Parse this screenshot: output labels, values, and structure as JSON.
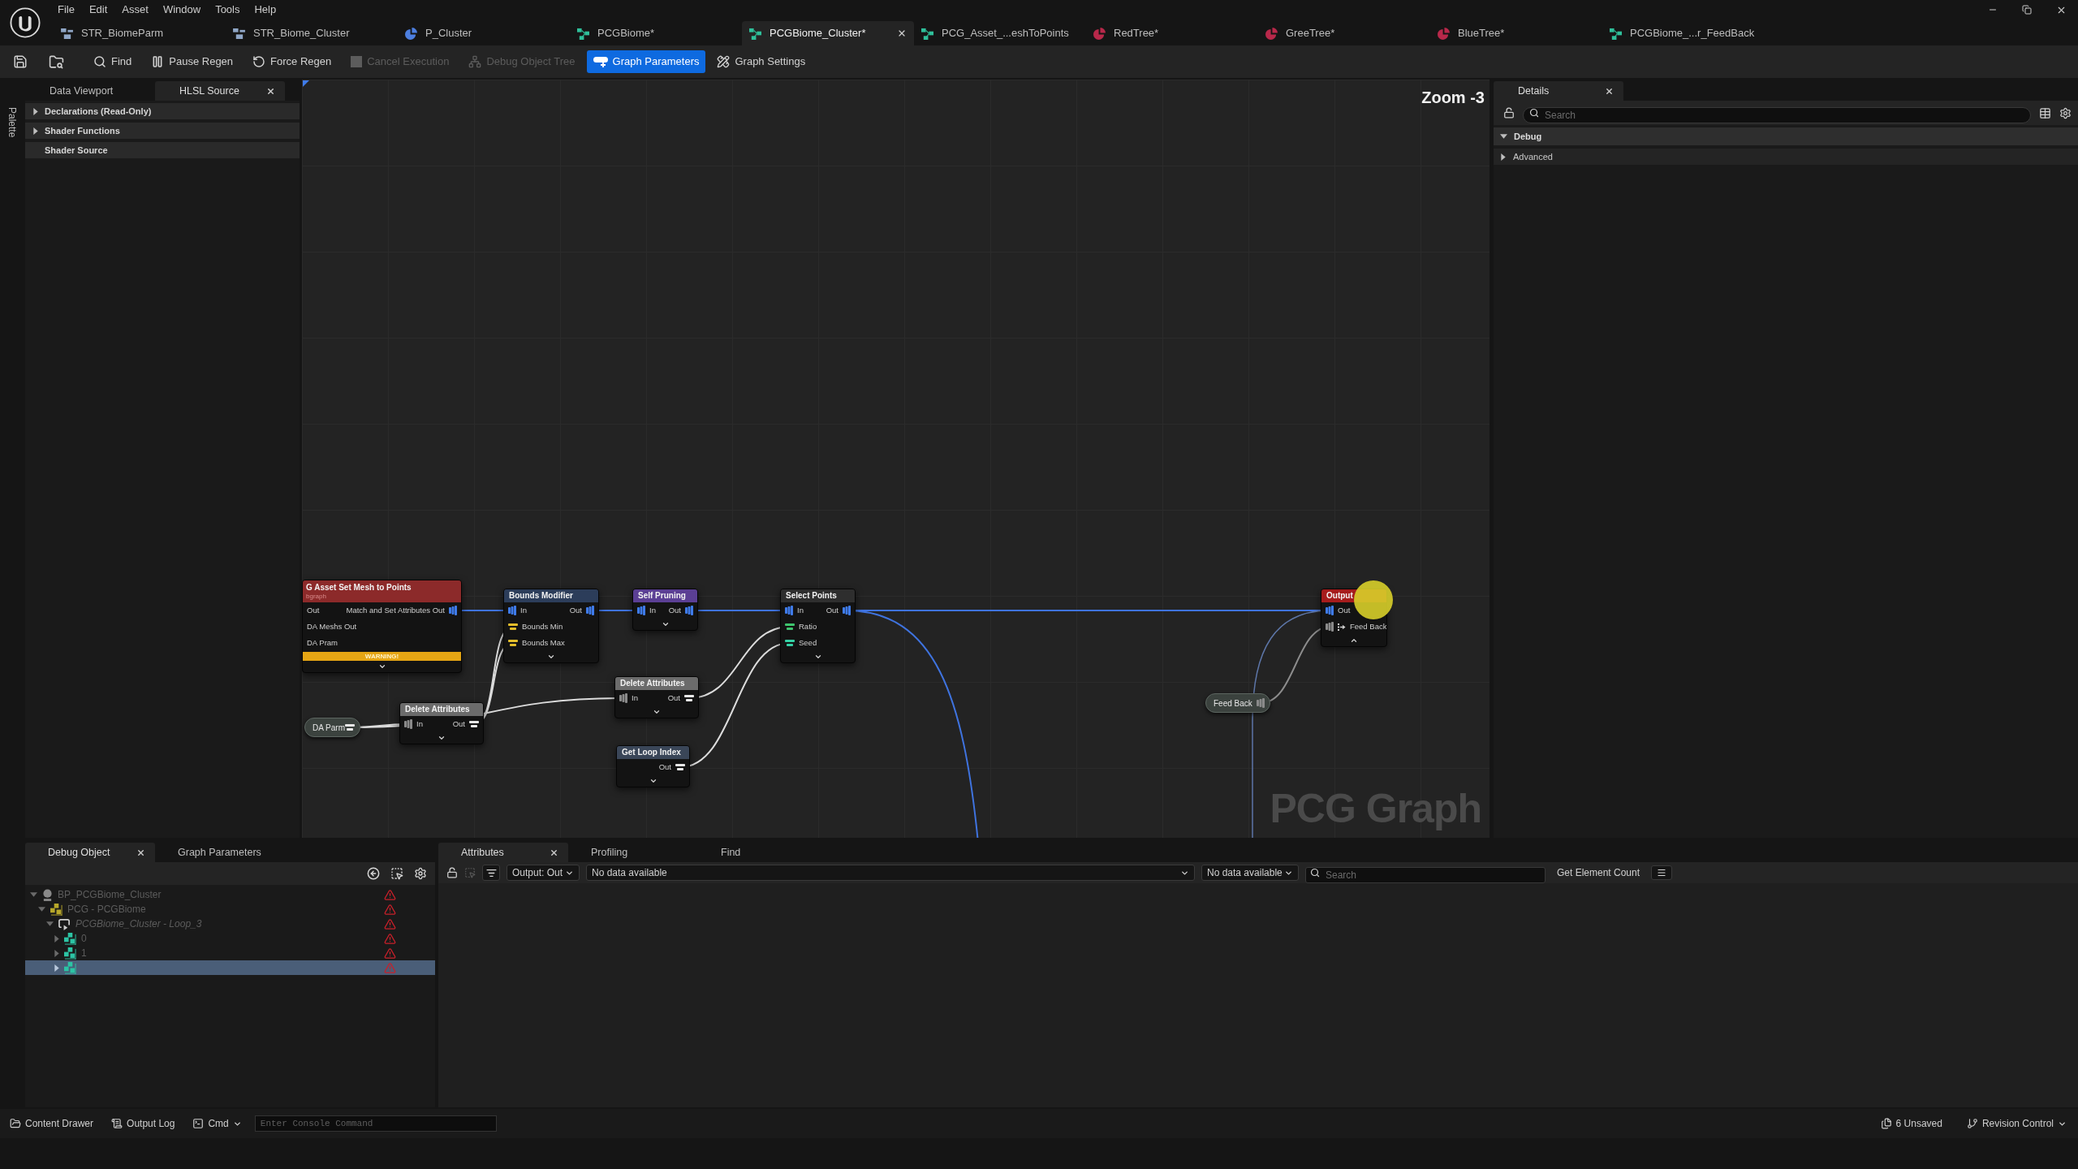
{
  "menu": [
    "File",
    "Edit",
    "Asset",
    "Window",
    "Tools",
    "Help"
  ],
  "tabs": [
    {
      "label": "STR_BiomeParm",
      "kind": "struct",
      "selected": false,
      "closable": false
    },
    {
      "label": "STR_Biome_Cluster",
      "kind": "struct",
      "selected": false,
      "closable": false
    },
    {
      "label": "P_Cluster",
      "kind": "data",
      "selected": false,
      "closable": false
    },
    {
      "label": "PCGBiome*",
      "kind": "graph",
      "selected": false,
      "closable": false
    },
    {
      "label": "PCGBiome_Cluster*",
      "kind": "graph",
      "selected": true,
      "closable": true
    },
    {
      "label": "PCG_Asset_...eshToPoints",
      "kind": "graph",
      "selected": false,
      "closable": false
    },
    {
      "label": "RedTree*",
      "kind": "material",
      "selected": false,
      "closable": false
    },
    {
      "label": "GreeTree*",
      "kind": "material",
      "selected": false,
      "closable": false
    },
    {
      "label": "BlueTree*",
      "kind": "material",
      "selected": false,
      "closable": false
    },
    {
      "label": "PCGBiome_...r_FeedBack",
      "kind": "graph",
      "selected": false,
      "closable": false
    }
  ],
  "toolbar": [
    {
      "label": "Find",
      "kind": "find",
      "disabled": false,
      "selected": false
    },
    {
      "label": "Pause Regen",
      "kind": "pause",
      "disabled": false,
      "selected": false
    },
    {
      "label": "Force Regen",
      "kind": "regen",
      "disabled": false,
      "selected": false
    },
    {
      "label": "Cancel Execution",
      "kind": "cancel",
      "disabled": true,
      "selected": false
    },
    {
      "label": "Debug Object Tree",
      "kind": "tree",
      "disabled": true,
      "selected": false
    },
    {
      "label": "Graph Parameters",
      "kind": "parameters",
      "disabled": false,
      "selected": true
    },
    {
      "label": "Graph Settings",
      "kind": "settings",
      "disabled": false,
      "selected": false
    }
  ],
  "palette": {
    "label": "Palette"
  },
  "left_panel": {
    "tabs": [
      {
        "label": "Data Viewport",
        "selected": false,
        "closable": false
      },
      {
        "label": "HLSL Source",
        "selected": true,
        "closable": true
      }
    ],
    "sections": [
      {
        "label": "Declarations (Read-Only)",
        "expandable": true
      },
      {
        "label": "Shader Functions",
        "expandable": true
      },
      {
        "label": "Shader Source",
        "expandable": false
      }
    ]
  },
  "graph": {
    "zoom": "Zoom -3",
    "watermark": "PCG Graph",
    "nodes": [
      {
        "kind": "node",
        "title": "G Asset Set Mesh to Points",
        "subtitle": "bgraph",
        "color": "#8c2a2a",
        "inputs": [
          {
            "label": "Out"
          },
          {
            "label": "DA Meshs Out"
          },
          {
            "label": "DA Pram"
          }
        ],
        "outputs": [
          {
            "label": "Match and Set Attributes Out",
            "kind": "point",
            "color": "#3f7bea"
          }
        ],
        "warning": "WARNING!",
        "expanded": false
      },
      {
        "kind": "node",
        "title": "Bounds Modifier",
        "color": "#2c3d5a",
        "inputs": [
          {
            "label": "In",
            "kind": "point",
            "color": "#3f7bea"
          },
          {
            "label": "Bounds Min",
            "kind": "param",
            "color": "#e3bd2a"
          },
          {
            "label": "Bounds Max",
            "kind": "param",
            "color": "#e3bd2a"
          }
        ],
        "outputs": [
          {
            "label": "Out",
            "kind": "point",
            "color": "#3f7bea"
          }
        ],
        "expanded": false
      },
      {
        "kind": "node",
        "title": "Self Pruning",
        "color": "#5b3f94",
        "inputs": [
          {
            "label": "In",
            "kind": "point",
            "color": "#3f7bea"
          }
        ],
        "outputs": [
          {
            "label": "Out",
            "kind": "point",
            "color": "#3f7bea"
          }
        ],
        "expanded": false
      },
      {
        "kind": "node",
        "title": "Select Points",
        "color": "#2e2e2e",
        "inputs": [
          {
            "label": "In",
            "kind": "point",
            "color": "#3f7bea"
          },
          {
            "label": "Ratio",
            "kind": "param",
            "color": "#3ec46d"
          },
          {
            "label": "Seed",
            "kind": "param",
            "color": "#35d0a5"
          }
        ],
        "outputs": [
          {
            "label": "Out",
            "kind": "point",
            "color": "#3f7bea"
          }
        ],
        "expanded": false
      },
      {
        "kind": "node",
        "title": "Output",
        "color": "#a61c1c",
        "inputs": [
          {
            "label": "Out",
            "kind": "point",
            "color": "#3f7bea",
            "loop_marker": false
          },
          {
            "label": "Feed Back",
            "kind": "spatial",
            "color": "#8a8a8a",
            "loop_marker": true
          }
        ],
        "expanded": true
      },
      {
        "kind": "pill",
        "title": "DA Parm",
        "color": "#3b423e",
        "outputs": [
          {
            "kind": "param",
            "color": "#e8e8e8"
          }
        ]
      },
      {
        "kind": "node",
        "title": "Delete Attributes",
        "color": "#6b6b6b",
        "inputs": [
          {
            "label": "In",
            "kind": "spatial",
            "color": "#8a8a8a"
          }
        ],
        "outputs": [
          {
            "label": "Out",
            "kind": "param",
            "color": "#e8e8e8"
          }
        ],
        "expanded": false
      },
      {
        "kind": "node",
        "title": "Delete Attributes",
        "color": "#6b6b6b",
        "inputs": [
          {
            "label": "In",
            "kind": "spatial",
            "color": "#8a8a8a"
          }
        ],
        "outputs": [
          {
            "label": "Out",
            "kind": "param",
            "color": "#e8e8e8"
          }
        ],
        "expanded": false
      },
      {
        "kind": "node",
        "title": "Get Loop Index",
        "color": "#3a4658",
        "outputs": [
          {
            "label": "Out",
            "kind": "param",
            "color": "#e8e8e8"
          }
        ],
        "expanded": false
      },
      {
        "kind": "pill",
        "title": "Feed Back",
        "color": "#3b423e",
        "outputs": [
          {
            "kind": "spatial",
            "color": "#8a8a8a"
          }
        ]
      }
    ]
  },
  "details": {
    "tab": {
      "label": "Details",
      "closable": true
    },
    "search": {
      "placeholder": "Search"
    },
    "categories": [
      {
        "label": "Debug",
        "expanded": true,
        "children": [
          {
            "label": "Advanced",
            "expanded": false
          }
        ]
      }
    ]
  },
  "debug_panel": {
    "tabs": [
      {
        "label": "Debug Object",
        "selected": true,
        "closable": true
      },
      {
        "label": "Graph Parameters",
        "selected": false,
        "closable": false
      }
    ],
    "tree": [
      {
        "label": "BP_PCGBiome_Cluster",
        "kind": "actor",
        "expanded": true,
        "selected": false,
        "warning": true,
        "children": [
          {
            "label": "PCG - PCGBiome",
            "kind": "component",
            "expanded": true,
            "selected": false,
            "warning": true,
            "children": [
              {
                "label": "PCGBiome_Cluster - Loop_3",
                "kind": "loop",
                "expanded": true,
                "selected": false,
                "warning": true,
                "children": [
                  {
                    "label": "0",
                    "kind": "graph",
                    "expanded": false,
                    "selected": false,
                    "warning": true
                  },
                  {
                    "label": "1",
                    "kind": "graph",
                    "expanded": false,
                    "selected": false,
                    "warning": true
                  },
                  {
                    "kind": "graph",
                    "expanded": false,
                    "selected": true,
                    "warning": true
                  }
                ]
              }
            ]
          }
        ]
      }
    ]
  },
  "attributes_panel": {
    "tabs": [
      {
        "label": "Attributes",
        "selected": true,
        "closable": true
      },
      {
        "label": "Profiling",
        "selected": false,
        "closable": false
      },
      {
        "label": "Find",
        "selected": false,
        "closable": false
      }
    ],
    "selects": [
      "Output: Out",
      "No data available",
      "No data available"
    ],
    "search": {
      "placeholder": "Search"
    },
    "count_button": "Get Element Count"
  },
  "status_bar": {
    "buttons": [
      {
        "label": "Content Drawer",
        "kind": "drawer",
        "dropdown": false
      },
      {
        "label": "Output Log",
        "kind": "log",
        "dropdown": false
      },
      {
        "label": "Cmd",
        "kind": "cmd",
        "dropdown": true
      }
    ],
    "console": {
      "placeholder": "Enter Console Command"
    },
    "right": [
      {
        "label": "6 Unsaved",
        "kind": "unsaved",
        "dropdown": false
      },
      {
        "label": "Revision Control",
        "kind": "revision",
        "dropdown": true
      }
    ]
  }
}
